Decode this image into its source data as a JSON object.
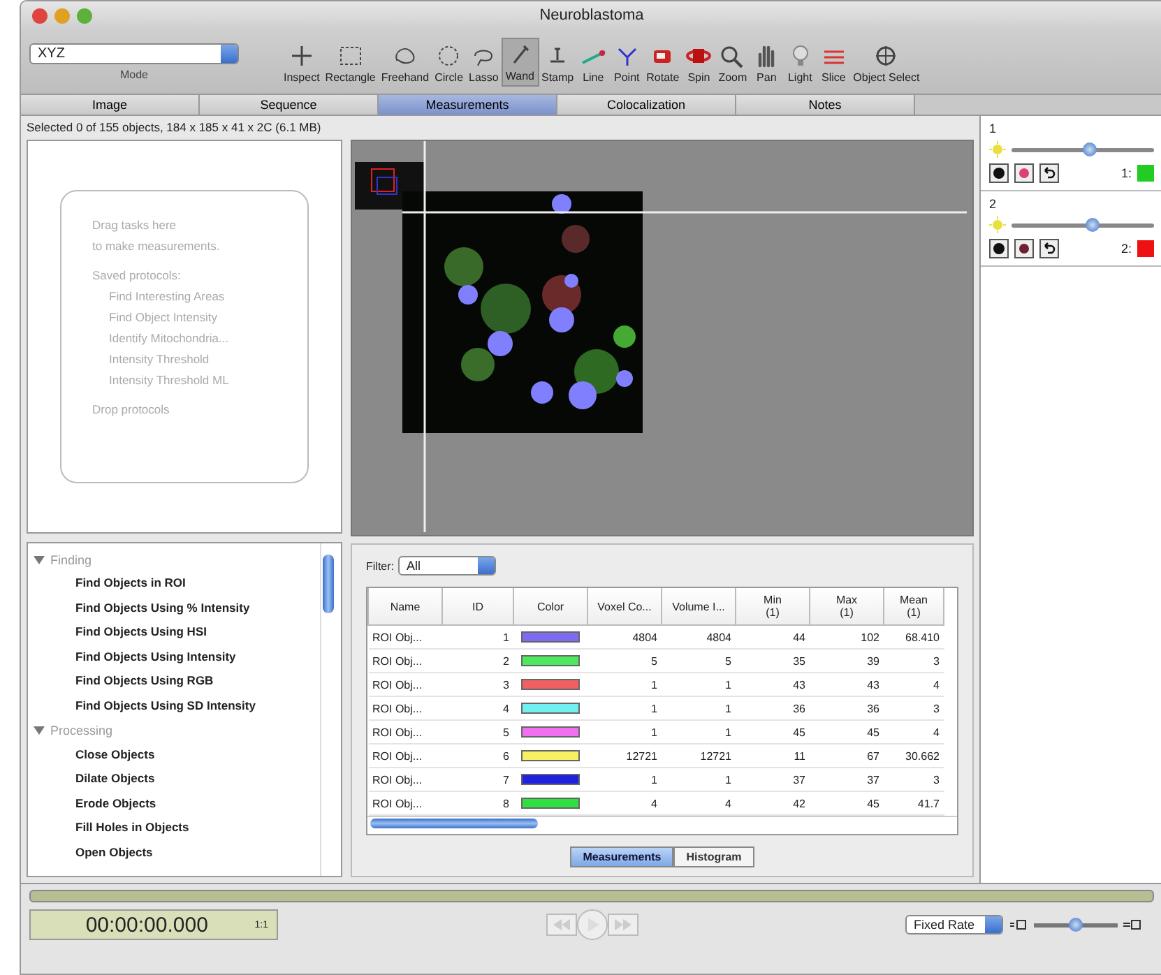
{
  "window": {
    "title": "Neuroblastoma"
  },
  "mode": {
    "value": "XYZ",
    "label": "Mode"
  },
  "tools": [
    {
      "label": "Inspect",
      "selected": false
    },
    {
      "label": "Rectangle",
      "selected": false
    },
    {
      "label": "Freehand",
      "selected": false
    },
    {
      "label": "Circle",
      "selected": false
    },
    {
      "label": "Lasso",
      "selected": false
    },
    {
      "label": "Wand",
      "selected": true
    },
    {
      "label": "Stamp",
      "selected": false
    },
    {
      "label": "Line",
      "selected": false
    },
    {
      "label": "Point",
      "selected": false
    },
    {
      "label": "Rotate",
      "selected": false
    },
    {
      "label": "Spin",
      "selected": false
    },
    {
      "label": "Zoom",
      "selected": false
    },
    {
      "label": "Pan",
      "selected": false
    },
    {
      "label": "Light",
      "selected": false
    },
    {
      "label": "Slice",
      "selected": false
    },
    {
      "label": "Object Select",
      "selected": false
    }
  ],
  "tabs": [
    {
      "label": "Image",
      "selected": false
    },
    {
      "label": "Sequence",
      "selected": false
    },
    {
      "label": "Measurements",
      "selected": true
    },
    {
      "label": "Colocalization",
      "selected": false
    },
    {
      "label": "Notes",
      "selected": false
    }
  ],
  "status": "Selected 0 of 155 objects, 184 x 185 x 41 x 2C (6.1 MB)",
  "drop_zone": {
    "lines": [
      "Drag tasks here",
      "to make measurements.",
      "Saved protocols:",
      "Find Interesting Areas",
      "Find Object Intensity",
      "Identify Mitochondria...",
      "Intensity Threshold",
      "Intensity Threshold ML",
      "Drop protocols"
    ]
  },
  "task_tree": [
    {
      "label": "Finding",
      "expanded": true,
      "children": [
        {
          "label": "Find Objects in ROI"
        },
        {
          "label": "Find Objects Using % Intensity"
        },
        {
          "label": "Find Objects Using HSI"
        },
        {
          "label": "Find Objects Using Intensity"
        },
        {
          "label": "Find Objects Using RGB"
        },
        {
          "label": "Find Objects Using SD Intensity"
        }
      ]
    },
    {
      "label": "Processing",
      "expanded": true,
      "children": [
        {
          "label": "Close Objects"
        },
        {
          "label": "Dilate Objects"
        },
        {
          "label": "Erode Objects"
        },
        {
          "label": "Fill Holes in Objects"
        },
        {
          "label": "Open Objects"
        }
      ]
    }
  ],
  "filter": {
    "label": "Filter:",
    "value": "All"
  },
  "table": {
    "columns": [
      "Name",
      "ID",
      "Color",
      "Voxel Co...",
      "Volume I...",
      "Min\n(1)",
      "Max\n(1)",
      "Mean\n(1)"
    ],
    "rows": [
      {
        "name": "ROI Obj...",
        "id": "1",
        "color": "#7b6cf0",
        "voxel_count": "4804",
        "volume": "4804",
        "min": "44",
        "max": "102",
        "mean": "68.410"
      },
      {
        "name": "ROI Obj...",
        "id": "2",
        "color": "#4ee860",
        "voxel_count": "5",
        "volume": "5",
        "min": "35",
        "max": "39",
        "mean": "3"
      },
      {
        "name": "ROI Obj...",
        "id": "3",
        "color": "#f06060",
        "voxel_count": "1",
        "volume": "1",
        "min": "43",
        "max": "43",
        "mean": "4"
      },
      {
        "name": "ROI Obj...",
        "id": "4",
        "color": "#70f0f0",
        "voxel_count": "1",
        "volume": "1",
        "min": "36",
        "max": "36",
        "mean": "3"
      },
      {
        "name": "ROI Obj...",
        "id": "5",
        "color": "#f070f0",
        "voxel_count": "1",
        "volume": "1",
        "min": "45",
        "max": "45",
        "mean": "4"
      },
      {
        "name": "ROI Obj...",
        "id": "6",
        "color": "#f8f060",
        "voxel_count": "12721",
        "volume": "12721",
        "min": "11",
        "max": "67",
        "mean": "30.662"
      },
      {
        "name": "ROI Obj...",
        "id": "7",
        "color": "#2020e0",
        "voxel_count": "1",
        "volume": "1",
        "min": "37",
        "max": "37",
        "mean": "3"
      },
      {
        "name": "ROI Obj...",
        "id": "8",
        "color": "#30e040",
        "voxel_count": "4",
        "volume": "4",
        "min": "42",
        "max": "45",
        "mean": "41.7"
      }
    ]
  },
  "view_tabs": [
    {
      "label": "Measurements",
      "selected": true
    },
    {
      "label": "Histogram",
      "selected": false
    }
  ],
  "channels": [
    {
      "name": "1",
      "level": 0.55,
      "key": "1:",
      "color": "#22cc22"
    },
    {
      "name": "2",
      "level": 0.57,
      "key": "2:",
      "color": "#ee1111"
    }
  ],
  "playback": {
    "time": "00:00:00.000",
    "ratio": "1:1",
    "rate": "Fixed Rate",
    "speed": {
      "level": 0.5
    }
  }
}
